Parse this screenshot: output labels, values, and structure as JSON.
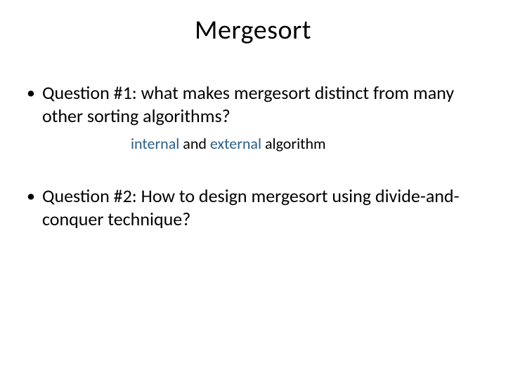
{
  "slide": {
    "title": "Mergesort",
    "bullets": [
      {
        "marker": "•",
        "text": "Question #1: what makes mergesort distinct from many other sorting algorithms?"
      },
      {
        "marker": "•",
        "text": "Question #2: How to design mergesort using divide-and-conquer technique?"
      }
    ],
    "subline": {
      "highlight1": "internal",
      "mid": " and ",
      "highlight2": "external",
      "tail": " algorithm"
    }
  }
}
